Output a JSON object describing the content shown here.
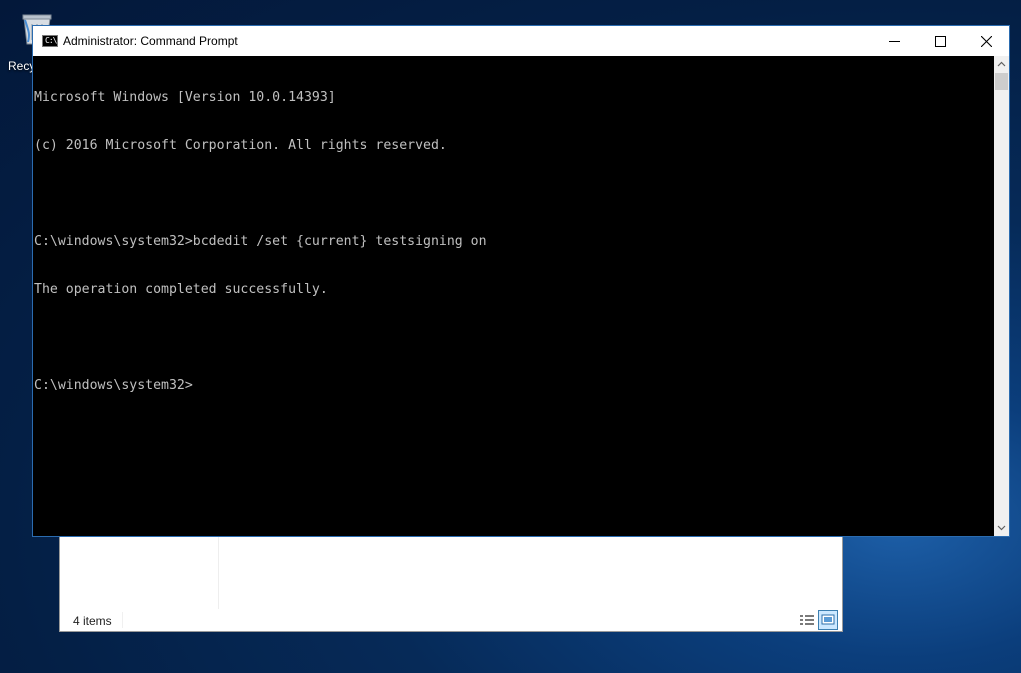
{
  "desktop": {
    "recycle_bin_label": "Recy"
  },
  "explorer": {
    "status_text": "4 items",
    "view_buttons": [
      "details-view-icon",
      "large-icons-view-icon"
    ]
  },
  "cmd": {
    "title": "Administrator: Command Prompt",
    "title_icon_text": "C:\\",
    "window_controls": [
      "minimize-icon",
      "maximize-icon",
      "close-icon"
    ],
    "lines": [
      "Microsoft Windows [Version 10.0.14393]",
      "(c) 2016 Microsoft Corporation. All rights reserved.",
      "",
      "C:\\windows\\system32>bcdedit /set {current} testsigning on",
      "The operation completed successfully.",
      "",
      "C:\\windows\\system32>"
    ],
    "colors": {
      "console_bg": "#000000",
      "console_fg": "#c0c0c0",
      "window_border": "#2b6cb0"
    }
  }
}
